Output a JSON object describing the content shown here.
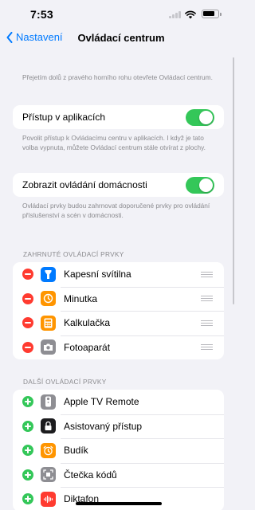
{
  "status_bar": {
    "time": "7:53",
    "battery_level": 0.8
  },
  "nav": {
    "back_label": "Nastavení",
    "title": "Ovládací centrum"
  },
  "intro_text": "Přejetím dolů z pravého horního rohu otevřete Ovládací centrum.",
  "access_in_apps": {
    "label": "Přístup v aplikacích",
    "enabled": true,
    "description": "Povolit přístup k Ovládacímu centru v aplikacích. I když je tato volba vypnuta, můžete Ovládací centrum stále otvírat z plochy."
  },
  "home_controls": {
    "label": "Zobrazit ovládání domácnosti",
    "enabled": true,
    "description": "Ovládací prvky budou zahrnovat doporučené prvky pro ovládání příslušenství a scén v domácnosti."
  },
  "included": {
    "header": "ZAHRNUTÉ OVLÁDACÍ PRVKY",
    "items": [
      {
        "label": "Kapesní svítilna",
        "icon": "flashlight-icon",
        "color": "#007aff"
      },
      {
        "label": "Minutka",
        "icon": "timer-icon",
        "color": "#ff9500"
      },
      {
        "label": "Kalkulačka",
        "icon": "calculator-icon",
        "color": "#ff9500"
      },
      {
        "label": "Fotoaparát",
        "icon": "camera-icon",
        "color": "#8e8e93"
      }
    ]
  },
  "more": {
    "header": "DALŠÍ OVLÁDACÍ PRVKY",
    "items": [
      {
        "label": "Apple TV Remote",
        "icon": "tv-remote-icon",
        "color": "#8e8e93"
      },
      {
        "label": "Asistovaný přístup",
        "icon": "lock-icon",
        "color": "#1c1c1e"
      },
      {
        "label": "Budík",
        "icon": "alarm-icon",
        "color": "#ff9500"
      },
      {
        "label": "Čtečka kódů",
        "icon": "code-scanner-icon",
        "color": "#8e8e93"
      },
      {
        "label": "Diktafon",
        "icon": "voice-memos-icon",
        "color": "#ff3b30"
      }
    ]
  },
  "colors": {
    "accent": "#007aff",
    "toggle_on": "#34c759",
    "remove": "#ff3b30",
    "add": "#34c759"
  }
}
